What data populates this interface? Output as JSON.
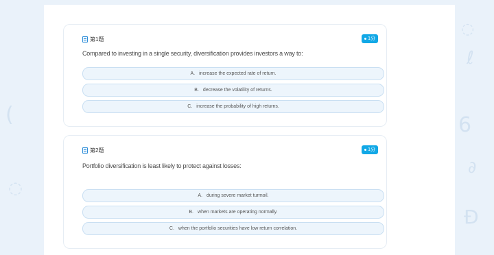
{
  "questions": [
    {
      "number_label": "第1题",
      "score_badge": "1分",
      "text": "Compared to investing in a single security, diversification provides investors a  way to:",
      "options": [
        {
          "letter": "A.",
          "text": "increase the expected rate of return."
        },
        {
          "letter": "B.",
          "text": "decrease the volatility of returns."
        },
        {
          "letter": "C.",
          "text": "increase the probability of high returns."
        }
      ]
    },
    {
      "number_label": "第2题",
      "score_badge": "1分",
      "text": "Portfolio diversification is least likely to protect against losses:",
      "options": [
        {
          "letter": "A.",
          "text": "during severe market turmoil."
        },
        {
          "letter": "B.",
          "text": "when markets are operating normally."
        },
        {
          "letter": "C.",
          "text": "when the portfolio securities have low return correlation."
        }
      ]
    }
  ]
}
